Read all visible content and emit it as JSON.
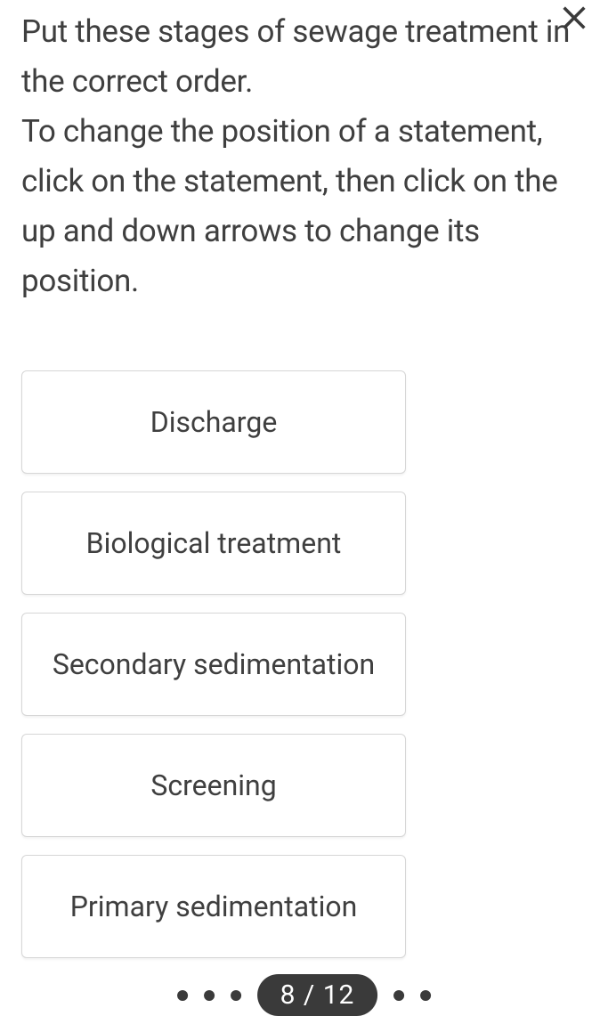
{
  "question": {
    "line1": "Put these stages of sewage treatment in the correct order.",
    "line2": "To change the position of a statement, click on the statement, then click on the up and down arrows to change its position."
  },
  "options": [
    "Discharge",
    "Biological treatment",
    "Secondary sedimentation",
    "Screening",
    "Primary sedimentation"
  ],
  "pager": {
    "label": "8 / 12"
  }
}
